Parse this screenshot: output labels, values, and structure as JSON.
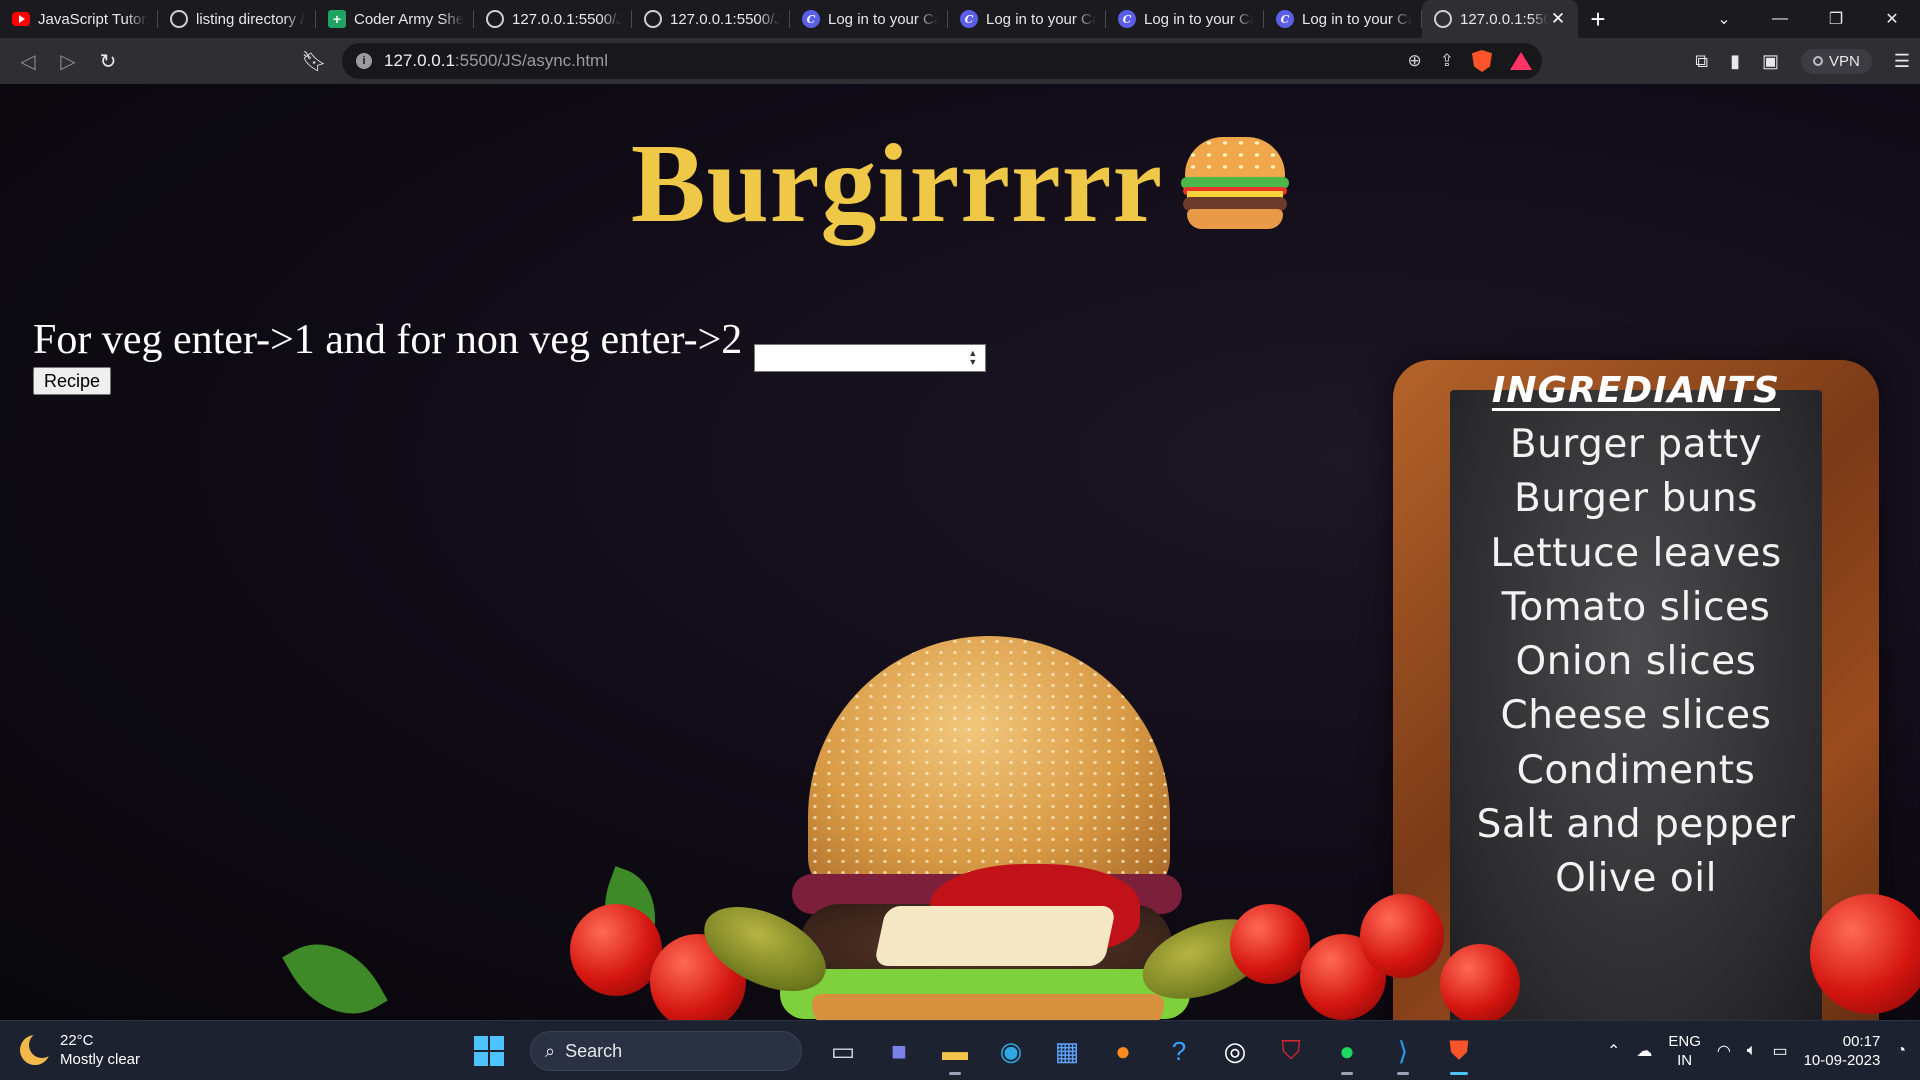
{
  "browser": {
    "tabs": [
      {
        "label": "JavaScript Tutorial",
        "icon": "youtube-icon",
        "active": false
      },
      {
        "label": "listing directory /",
        "icon": "globe-icon",
        "active": false
      },
      {
        "label": "Coder Army Sheet",
        "icon": "sheets-icon",
        "active": false
      },
      {
        "label": "127.0.0.1:5500/JS",
        "icon": "globe-icon",
        "active": false
      },
      {
        "label": "127.0.0.1:5500/JS",
        "icon": "globe-icon",
        "active": false
      },
      {
        "label": "Log in to your Canva",
        "icon": "canva-icon",
        "active": false
      },
      {
        "label": "Log in to your Canva",
        "icon": "canva-icon",
        "active": false
      },
      {
        "label": "Log in to your Canva",
        "icon": "canva-icon",
        "active": false
      },
      {
        "label": "Log in to your Canva",
        "icon": "canva-icon",
        "active": false
      },
      {
        "label": "127.0.0.1:5500",
        "icon": "globe-icon",
        "active": true
      }
    ],
    "url_host": "127.0.0.1",
    "url_path": ":5500/JS/async.html",
    "vpn_label": "VPN"
  },
  "page": {
    "title": "Burgirrrrr",
    "title_emoji": "burger-icon",
    "prompt": "For veg enter->1 and for non veg enter->2",
    "number_input_value": "",
    "recipe_button": "Recipe",
    "board_title": "INGREDIANTS",
    "ingredients": [
      "Burger patty",
      "Burger buns",
      "Lettuce leaves",
      "Tomato slices",
      "Onion slices",
      "Cheese slices",
      "Condiments",
      "Salt and pepper",
      "Olive oil"
    ],
    "title_color": "#efc848"
  },
  "taskbar": {
    "temperature": "22°C",
    "weather": "Mostly clear",
    "search_placeholder": "Search",
    "lang_line1": "ENG",
    "lang_line2": "IN",
    "time": "00:17",
    "date": "10-09-2023"
  }
}
